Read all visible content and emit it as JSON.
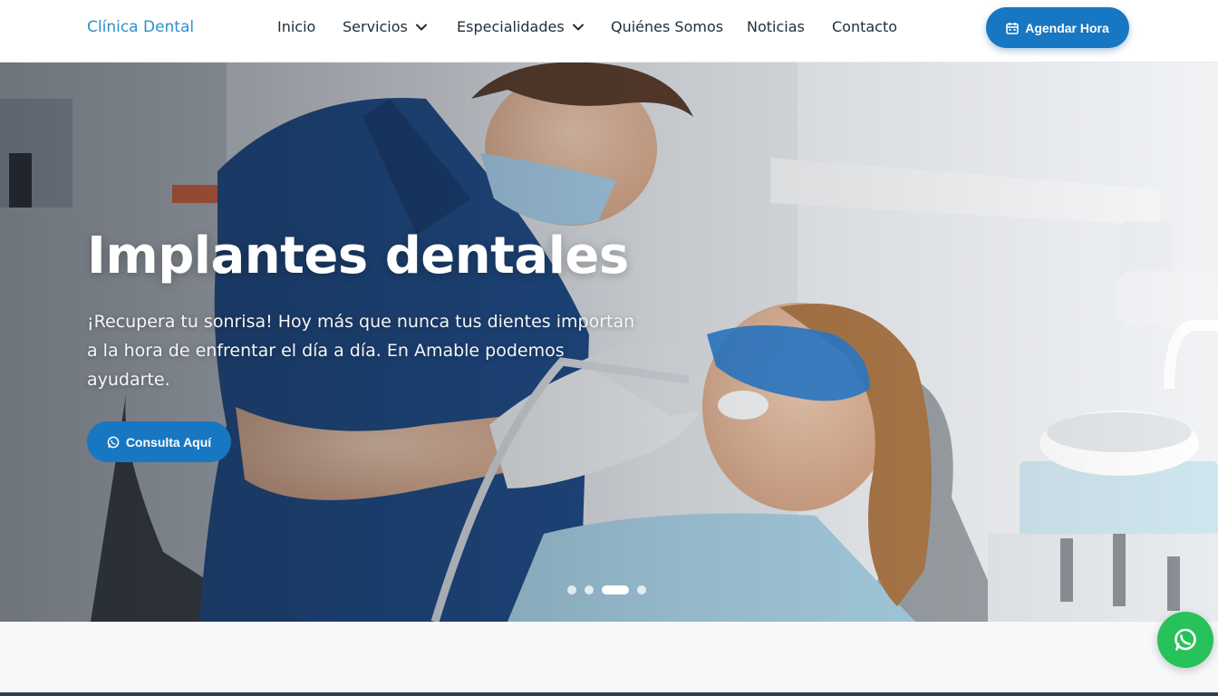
{
  "header": {
    "logo": "Clínica Dental",
    "nav": [
      {
        "label": "Inicio",
        "dropdown": false
      },
      {
        "label": "Servicios",
        "dropdown": true
      },
      {
        "label": "Especialidades",
        "dropdown": true
      },
      {
        "label": "Quiénes Somos",
        "dropdown": false
      },
      {
        "label": "Noticias",
        "dropdown": false
      },
      {
        "label": "Contacto",
        "dropdown": false
      }
    ],
    "cta_label": "Agendar Hora",
    "cta_icon": "calendar-icon"
  },
  "hero": {
    "title": "Implantes dentales",
    "text": "¡Recupera tu sonrisa! Hoy más que nunca tus dientes importan a la hora de enfrentar el día a día. En Amable podemos ayudarte.",
    "button_label": "Consulta Aquí",
    "button_icon": "whatsapp-icon",
    "slides_total": 4,
    "active_slide": 3
  },
  "floating": {
    "whatsapp_icon": "whatsapp-icon"
  },
  "colors": {
    "accent": "#1877c2",
    "logo": "#2f8fc9",
    "whatsapp": "#27c25a"
  }
}
